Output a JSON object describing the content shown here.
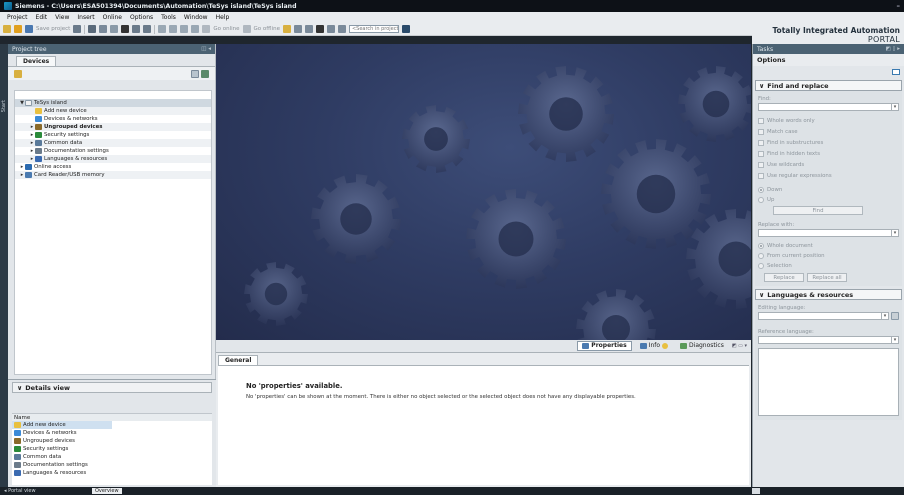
{
  "window": {
    "title": "Siemens - C:\\Users\\ESA501394\\Documents\\Automation\\TeSys island\\TeSys island"
  },
  "menu": [
    "Project",
    "Edit",
    "View",
    "Insert",
    "Online",
    "Options",
    "Tools",
    "Window",
    "Help"
  ],
  "toolbar": {
    "save_project": "Save project",
    "go_online": "Go online",
    "go_offline": "Go offline",
    "search_placeholder": "<Search in project>"
  },
  "brand": {
    "line1": "Totally Integrated Automation",
    "line2": "PORTAL"
  },
  "project_tree": {
    "header": "Project tree",
    "tab": "Devices",
    "items": [
      {
        "label": "TeSys island",
        "level": 0,
        "arrow": "▼",
        "icon": "project-icon",
        "color": "#f2f2f2"
      },
      {
        "label": "Add new device",
        "level": 1,
        "arrow": "",
        "icon": "add-device-icon",
        "color": "#e8c040"
      },
      {
        "label": "Devices & networks",
        "level": 1,
        "arrow": "",
        "icon": "network-icon",
        "color": "#3a8ad8"
      },
      {
        "label": "Ungrouped devices",
        "level": 1,
        "arrow": "▸",
        "icon": "folder-icon",
        "color": "#8a6a2a",
        "bold": true
      },
      {
        "label": "Security settings",
        "level": 1,
        "arrow": "▸",
        "icon": "security-icon",
        "color": "#2a8a3a"
      },
      {
        "label": "Common data",
        "level": 1,
        "arrow": "▸",
        "icon": "common-data-icon",
        "color": "#5a7a9a"
      },
      {
        "label": "Documentation settings",
        "level": 1,
        "arrow": "▸",
        "icon": "documentation-icon",
        "color": "#6a7a8a"
      },
      {
        "label": "Languages & resources",
        "level": 1,
        "arrow": "▸",
        "icon": "languages-icon",
        "color": "#3a6ab0"
      },
      {
        "label": "Online access",
        "level": 0,
        "arrow": "▸",
        "icon": "online-access-icon",
        "color": "#2a6ab0"
      },
      {
        "label": "Card Reader/USB memory",
        "level": 0,
        "arrow": "▸",
        "icon": "card-reader-icon",
        "color": "#4a7ab0"
      }
    ]
  },
  "start_strip": {
    "label": "Start"
  },
  "details_view": {
    "header": "Details view",
    "column_name": "Name",
    "items": [
      {
        "label": "Add new device",
        "icon": "add-device-icon",
        "color": "#e8c040"
      },
      {
        "label": "Devices & networks",
        "icon": "network-icon",
        "color": "#3a8ad8"
      },
      {
        "label": "Ungrouped devices",
        "icon": "folder-icon",
        "color": "#8a6a2a"
      },
      {
        "label": "Security settings",
        "icon": "security-icon",
        "color": "#2a8a3a"
      },
      {
        "label": "Common data",
        "icon": "common-data-icon",
        "color": "#5a7a9a"
      },
      {
        "label": "Documentation settings",
        "icon": "documentation-icon",
        "color": "#6a7a8a"
      },
      {
        "label": "Languages & resources",
        "icon": "languages-icon",
        "color": "#3a6ab0"
      }
    ]
  },
  "inspector": {
    "tabs": {
      "properties": "Properties",
      "info": "Info",
      "diagnostics": "Diagnostics"
    },
    "subtab": "General",
    "title": "No 'properties' available.",
    "subtitle": "No 'properties' can be shown at the moment. There is either no object selected or the selected object does not have any displayable properties."
  },
  "tasks": {
    "header": "Tasks",
    "options": "Options",
    "find_replace": {
      "header": "Find and replace",
      "find_label": "Find:",
      "checks": [
        "Whole words only",
        "Match case",
        "Find in substructures",
        "Find in hidden texts",
        "Use wildcards",
        "Use regular expressions"
      ],
      "dir_down": "Down",
      "dir_up": "Up",
      "find_btn": "Find",
      "replace_with": "Replace with:",
      "scope": [
        "Whole document",
        "From current position",
        "Selection"
      ],
      "replace_btn": "Replace",
      "replace_all_btn": "Replace all"
    },
    "languages": {
      "header": "Languages & resources",
      "editing": "Editing language:",
      "reference": "Reference language:"
    }
  },
  "statusbar": {
    "portal_view": "Portal view",
    "overview": "Overview"
  }
}
